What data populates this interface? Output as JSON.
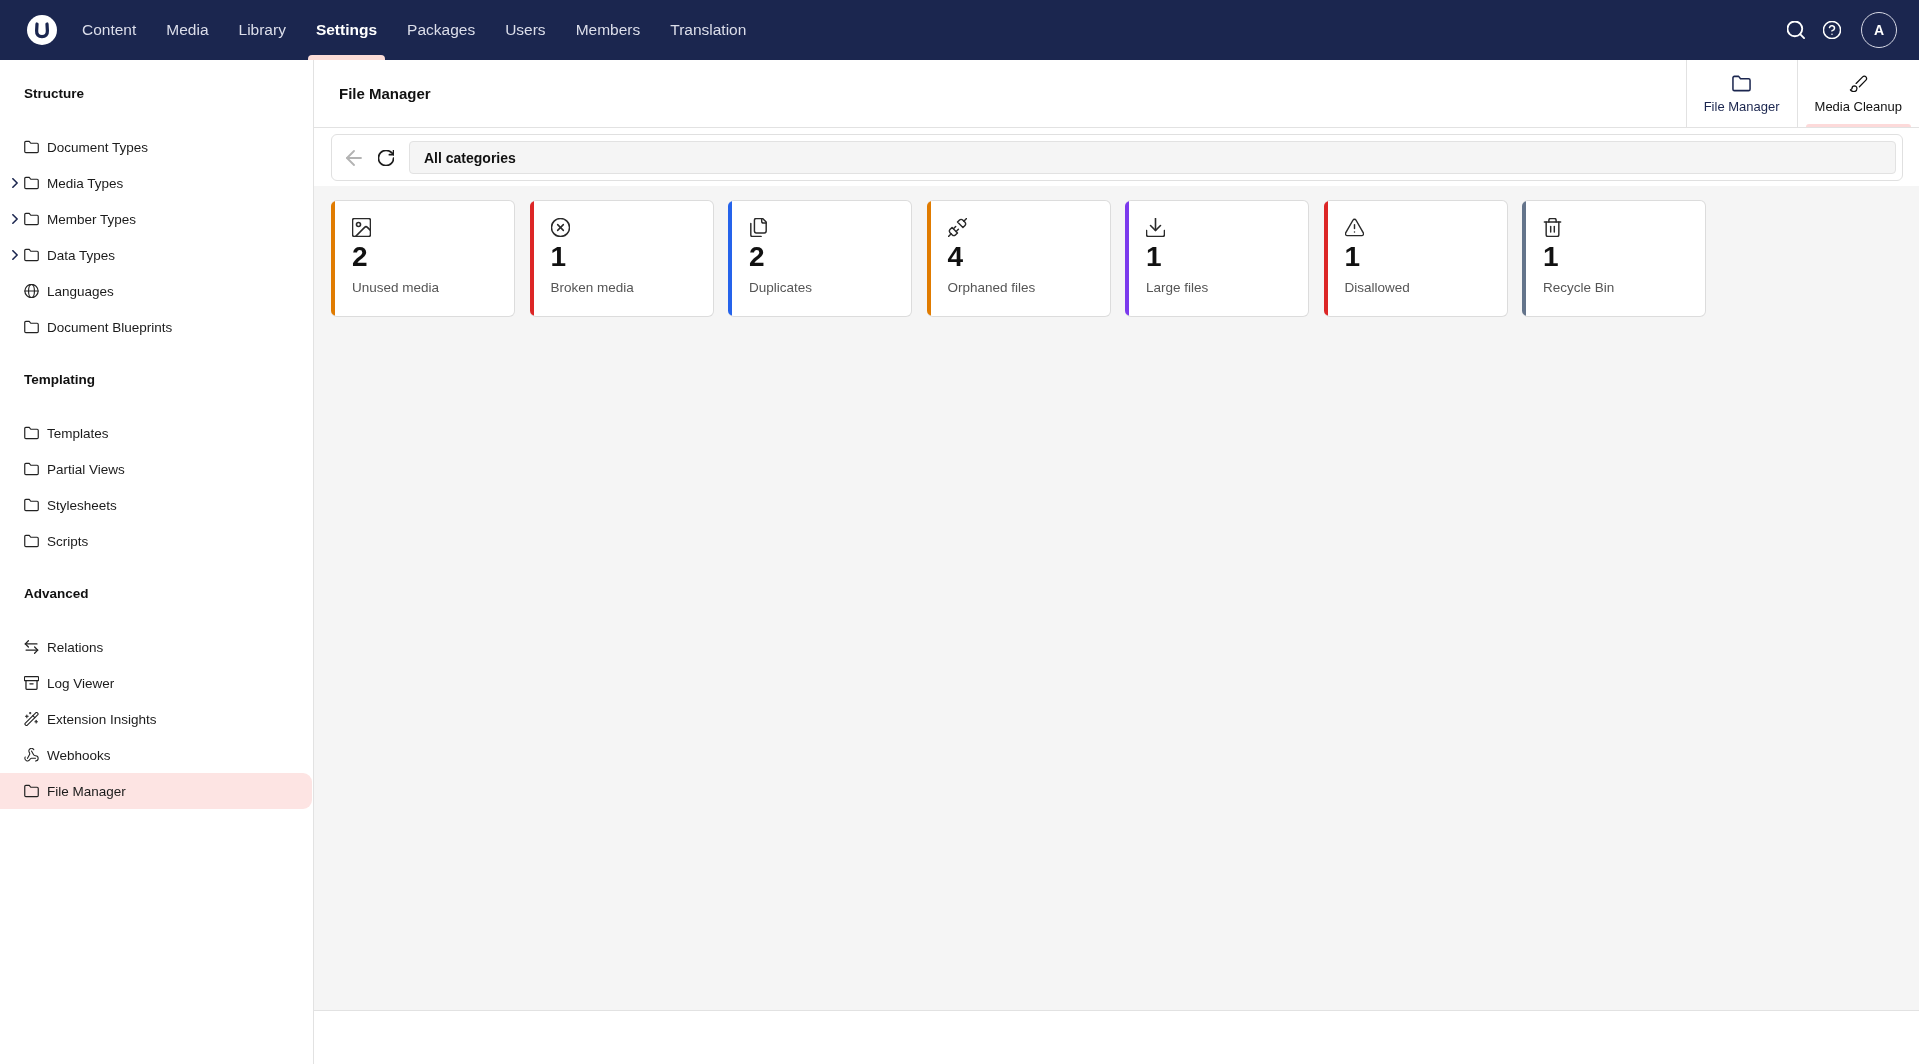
{
  "top_bar": {
    "nav": [
      {
        "label": "Content",
        "selected": false
      },
      {
        "label": "Media",
        "selected": false
      },
      {
        "label": "Library",
        "selected": false
      },
      {
        "label": "Settings",
        "selected": true
      },
      {
        "label": "Packages",
        "selected": false
      },
      {
        "label": "Users",
        "selected": false
      },
      {
        "label": "Members",
        "selected": false
      },
      {
        "label": "Translation",
        "selected": false
      }
    ],
    "avatar": "A"
  },
  "sidebar": {
    "sections": [
      {
        "title": "Structure",
        "items": [
          {
            "label": "Document Types",
            "expandable": false,
            "selected": false
          },
          {
            "label": "Media Types",
            "expandable": true,
            "selected": false
          },
          {
            "label": "Member Types",
            "expandable": true,
            "selected": false
          },
          {
            "label": "Data Types",
            "expandable": true,
            "selected": false
          },
          {
            "label": "Languages",
            "expandable": false,
            "selected": false
          },
          {
            "label": "Document Blueprints",
            "expandable": false,
            "selected": false
          }
        ]
      },
      {
        "title": "Templating",
        "items": [
          {
            "label": "Templates",
            "expandable": false,
            "selected": false
          },
          {
            "label": "Partial Views",
            "expandable": false,
            "selected": false
          },
          {
            "label": "Stylesheets",
            "expandable": false,
            "selected": false
          },
          {
            "label": "Scripts",
            "expandable": false,
            "selected": false
          }
        ]
      },
      {
        "title": "Advanced",
        "items": [
          {
            "label": "Relations",
            "expandable": false,
            "selected": false
          },
          {
            "label": "Log Viewer",
            "expandable": false,
            "selected": false
          },
          {
            "label": "Extension Insights",
            "expandable": false,
            "selected": false
          },
          {
            "label": "Webhooks",
            "expandable": false,
            "selected": false
          },
          {
            "label": "File Manager",
            "expandable": false,
            "selected": true
          }
        ]
      }
    ]
  },
  "header": {
    "title": "File Manager",
    "tabs": [
      {
        "label": "File Manager",
        "selected": false
      },
      {
        "label": "Media Cleanup",
        "selected": true
      }
    ]
  },
  "toolbar": {
    "back_disabled": true,
    "path": "All categories"
  },
  "cards": [
    {
      "count": "2",
      "label": "Unused media",
      "color": "#e07b00"
    },
    {
      "count": "1",
      "label": "Broken media",
      "color": "#dc2626"
    },
    {
      "count": "2",
      "label": "Duplicates",
      "color": "#2563eb"
    },
    {
      "count": "4",
      "label": "Orphaned files",
      "color": "#e07b00"
    },
    {
      "count": "1",
      "label": "Large files",
      "color": "#7c3aed"
    },
    {
      "count": "1",
      "label": "Disallowed",
      "color": "#dc2626"
    },
    {
      "count": "1",
      "label": "Recycle Bin",
      "color": "#64748b"
    }
  ]
}
